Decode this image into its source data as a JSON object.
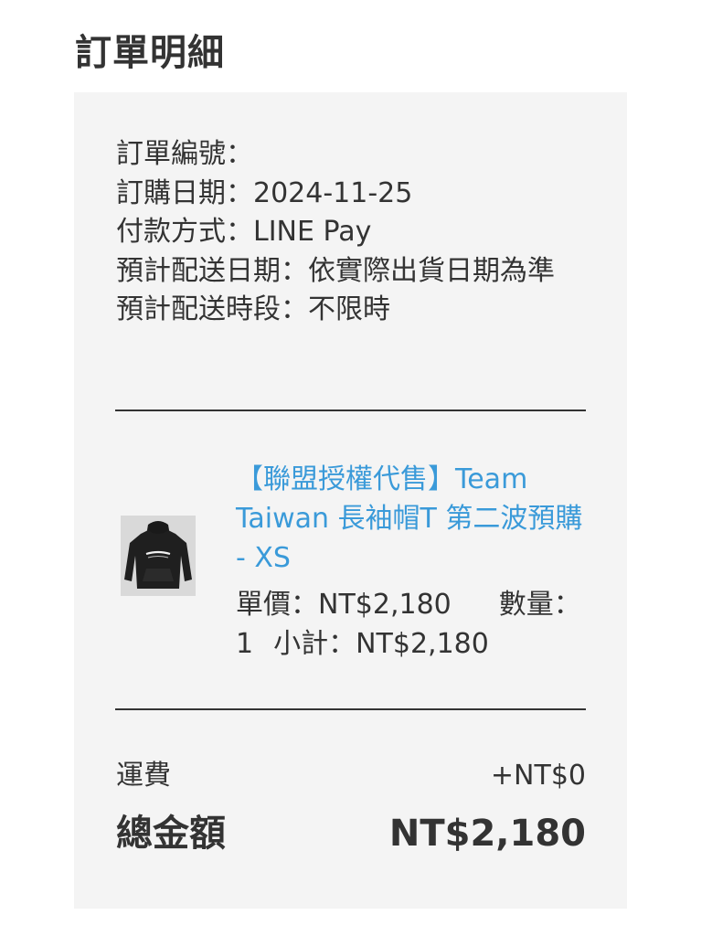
{
  "page": {
    "title": "訂單明細"
  },
  "order_info": {
    "order_number": "訂單編號：",
    "order_date": "訂購日期：2024-11-25",
    "payment_method": "付款方式：LINE Pay",
    "delivery_date": "預計配送日期：依實際出貨日期為準",
    "delivery_time": "預計配送時段：不限時"
  },
  "product": {
    "name": "【聯盟授權代售】Team Taiwan 長袖帽T 第二波預購 - XS",
    "image_icon": "hoodie-product-image",
    "unit_price": "單價：NT$2,180",
    "quantity": "數量：1",
    "subtotal": "小計：NT$2,180"
  },
  "summary": {
    "shipping_label": "運費",
    "shipping_value": "+NT$0",
    "total_label": "總金額",
    "total_value": "NT$2,180"
  },
  "colors": {
    "product_link": "#3a9ad9",
    "card_background": "#f4f4f4",
    "text": "#333333"
  }
}
